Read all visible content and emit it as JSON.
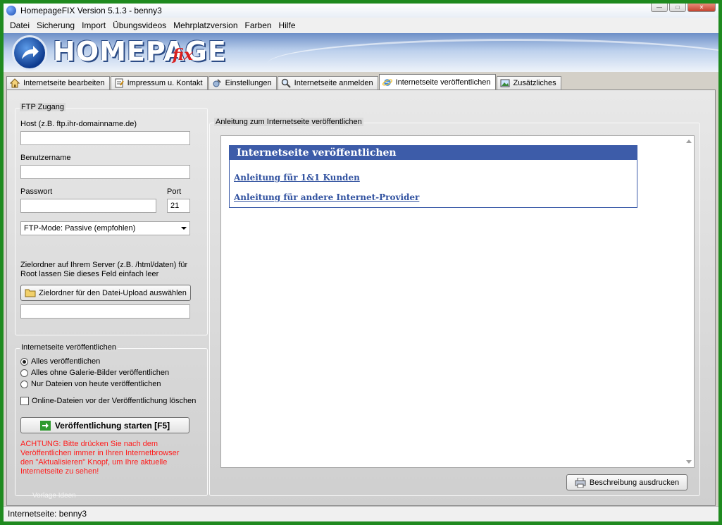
{
  "window": {
    "title": "HomepageFIX Version 5.1.3 - benny3",
    "controls": {
      "minimize": "—",
      "maximize": "□",
      "close": "✕"
    }
  },
  "menu": [
    "Datei",
    "Sicherung",
    "Import",
    "Übungsvideos",
    "Mehrplatzversion",
    "Farben",
    "Hilfe"
  ],
  "banner": {
    "logo_text": "HOMEPAGE",
    "logo_suffix": "fix"
  },
  "tabs": [
    {
      "label": "Internetseite bearbeiten",
      "icon": "house-icon"
    },
    {
      "label": "Impressum u. Kontakt",
      "icon": "notepad-icon"
    },
    {
      "label": "Einstellungen",
      "icon": "settings-icon"
    },
    {
      "label": "Internetseite anmelden",
      "icon": "magnifier-icon"
    },
    {
      "label": "Internetseite veröffentlichen",
      "icon": "internet-explorer-icon",
      "active": true
    },
    {
      "label": "Zusätzliches",
      "icon": "picture-icon"
    }
  ],
  "ftp": {
    "legend": "FTP Zugang",
    "host_label": "Host (z.B. ftp.ihr-domainname.de)",
    "host_value": "",
    "user_label": "Benutzername",
    "user_value": "",
    "password_label": "Passwort",
    "password_value": "",
    "port_label": "Port",
    "port_value": "21",
    "mode_value": "FTP-Mode: Passive (empfohlen)",
    "folder_hint": "Zielordner auf Ihrem Server (z.B. /html/daten) für Root lassen Sie dieses Feld einfach leer",
    "folder_button": "Zielordner für den Datei-Upload auswählen",
    "folder_value": ""
  },
  "publish": {
    "legend": "Internetseite veröffentlichen",
    "options": [
      "Alles veröffentlichen",
      "Alles ohne Galerie-Bilder veröffentlichen",
      "Nur Dateien von heute veröffentlichen"
    ],
    "selected_index": 0,
    "delete_checkbox": "Online-Dateien vor der Veröffentlichung löschen",
    "delete_checked": false,
    "start_button": "Veröffentlichung starten [F5]",
    "warning": "ACHTUNG: Bitte drücken Sie nach dem Veröffentlichen immer in Ihren Internetbrowser den \"Aktualisieren\" Knopf, um Ihre aktuelle Internetseite zu sehen!",
    "watermark": "Vorlage Ideen"
  },
  "guide": {
    "legend": "Anleitung zum Internetseite veröffentlichen",
    "box_title": "Internetseite veröffentlichen",
    "links": [
      "Anleitung für 1&1 Kunden",
      "Anleitung für andere Internet-Provider"
    ],
    "print_button": "Beschreibung ausdrucken"
  },
  "status": {
    "text": "Internetseite: benny3"
  },
  "colors": {
    "frame": "#1f8a1f",
    "accent": "#3d5ca9",
    "warning": "#ff1d1d",
    "link": "#3152a0"
  }
}
